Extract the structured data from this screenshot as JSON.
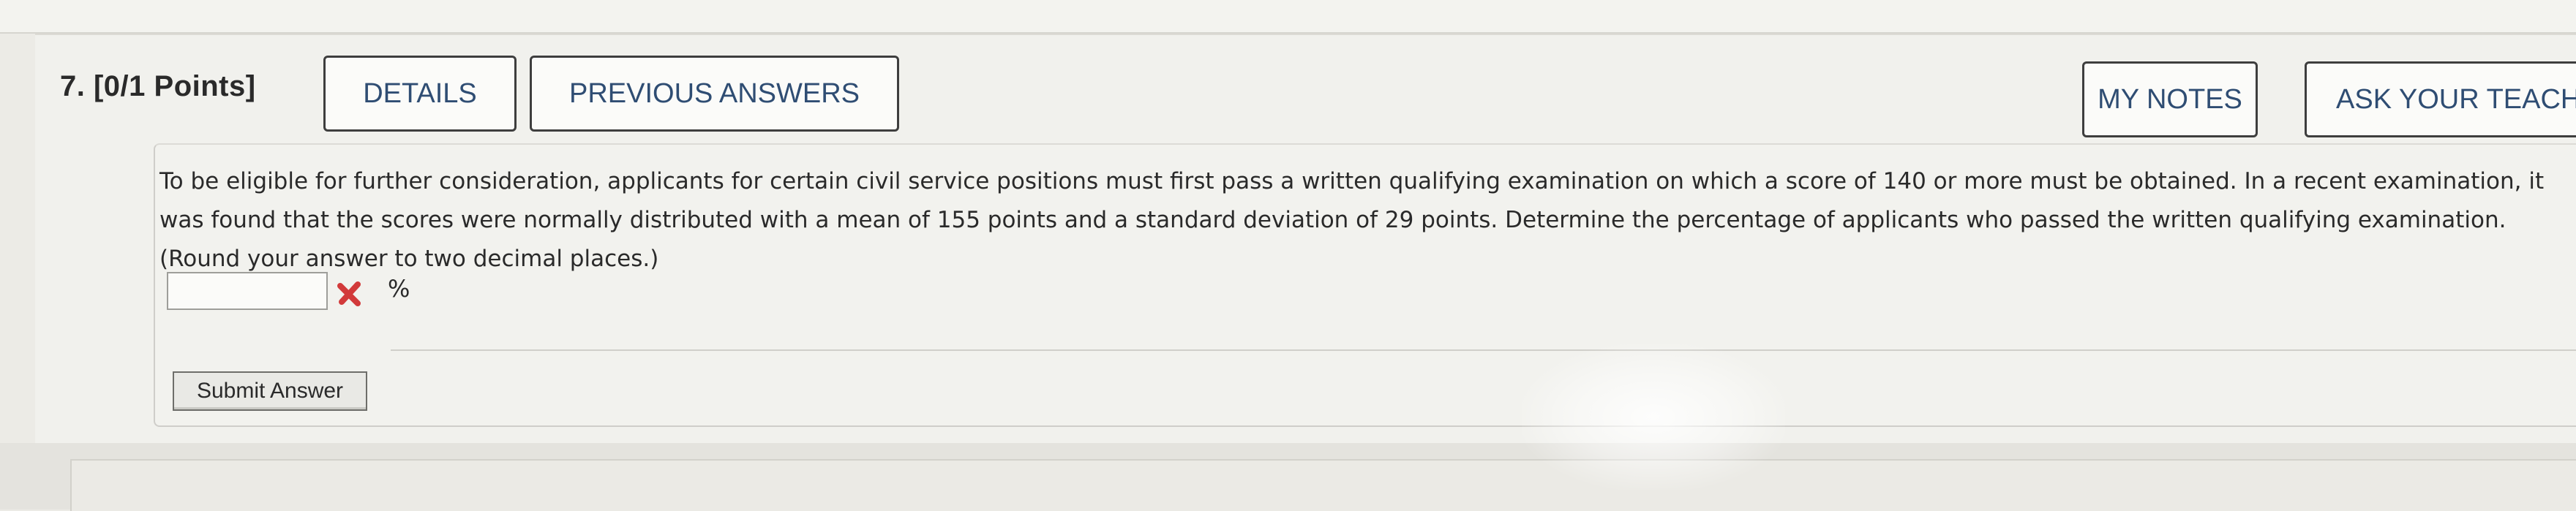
{
  "question": {
    "number_label": "7.  [0/1 Points]",
    "text": "To be eligible for further consideration, applicants for certain civil service positions must first pass a written qualifying examination on which a score of 140 or more must be obtained. In a recent examination, it was found that the scores were normally distributed with a mean of 155 points and a standard deviation of 29 points. Determine the percentage of applicants who passed the written qualifying examination. (Round your answer to two decimal places.)"
  },
  "toolbar": {
    "details_label": "DETAILS",
    "previous_answers_label": "PREVIOUS ANSWERS",
    "my_notes_label": "MY NOTES",
    "ask_teacher_label": "ASK YOUR TEACH"
  },
  "answer": {
    "value": "",
    "unit": "%",
    "status_icon": "incorrect-x-icon",
    "status_color": "#d23a3a"
  },
  "submit": {
    "label": "Submit Answer"
  },
  "colors": {
    "button_text": "#2f4d73",
    "background": "#ecebe6"
  }
}
